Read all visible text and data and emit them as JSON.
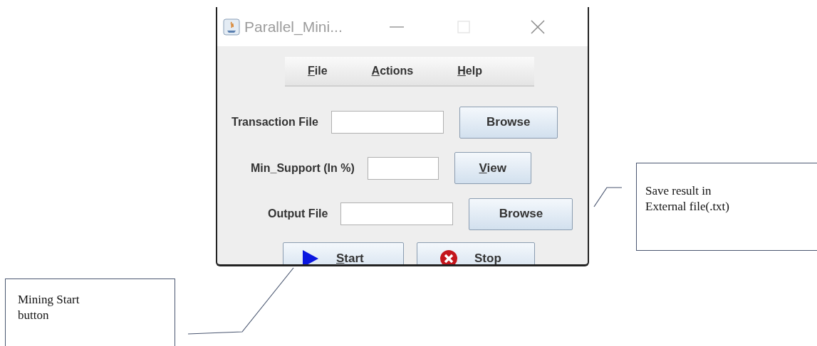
{
  "window": {
    "title": "Parallel_Mini..."
  },
  "menu": [
    {
      "mnemonic": "F",
      "rest": "ile"
    },
    {
      "mnemonic": "A",
      "rest": "ctions"
    },
    {
      "mnemonic": "H",
      "rest": "elp"
    }
  ],
  "rows": [
    {
      "label": "Transaction File",
      "button": {
        "label": "Browse"
      }
    },
    {
      "label": "Min_Support (In %)",
      "button": {
        "mnemonic": "V",
        "rest": "iew"
      }
    },
    {
      "label": "Output File",
      "button": {
        "label": "Browse"
      }
    }
  ],
  "actions": [
    {
      "kind": "start",
      "mnemonic": "S",
      "rest": "tart"
    },
    {
      "kind": "stop",
      "label": "Stop"
    }
  ],
  "callouts": [
    {
      "text": "Save result in External file(.txt)"
    },
    {
      "text": "Mining Start button"
    }
  ]
}
